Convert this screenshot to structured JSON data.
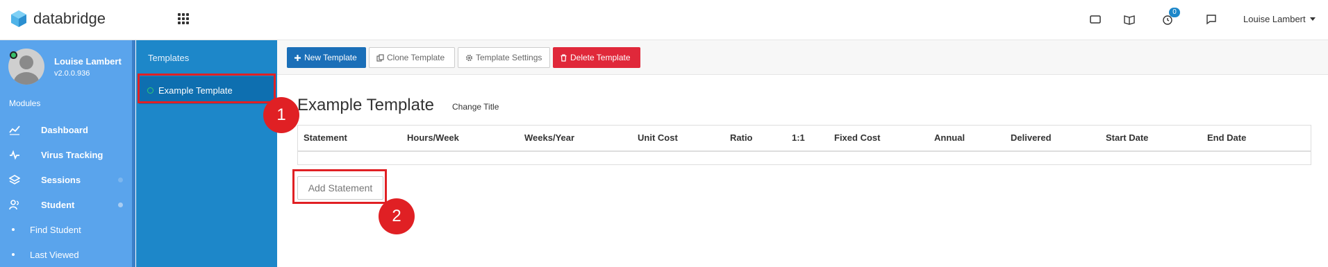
{
  "app": {
    "brand": "databridge",
    "brand_color": "#4fb3e8"
  },
  "topbar": {
    "icons": [
      "tablet-icon",
      "book-icon",
      "clock-icon",
      "chat-icon"
    ],
    "notification_count": "0",
    "user_name": "Louise Lambert"
  },
  "sidebar": {
    "profile_name": "Louise Lambert",
    "version": "v2.0.0.936",
    "modules_label": "Modules",
    "items": [
      {
        "label": "Dashboard",
        "icon": "chart-line-icon"
      },
      {
        "label": "Virus Tracking",
        "icon": "pulse-icon"
      },
      {
        "label": "Sessions",
        "icon": "layers-icon"
      },
      {
        "label": "Student",
        "icon": "students-icon"
      }
    ],
    "sub_items": [
      {
        "label": "Find Student"
      },
      {
        "label": "Last Viewed"
      }
    ]
  },
  "templates_panel": {
    "heading": "Templates",
    "items": [
      {
        "label": "Example Template"
      }
    ]
  },
  "toolbar": {
    "new_label": "New Template",
    "clone_label": "Clone Template",
    "settings_label": "Template Settings",
    "delete_label": "Delete Template"
  },
  "main": {
    "title": "Example Template",
    "change_title_label": "Change Title",
    "columns": [
      "Statement",
      "Hours/Week",
      "Weeks/Year",
      "Unit Cost",
      "Ratio",
      "1:1",
      "Fixed Cost",
      "Annual",
      "Delivered",
      "Start Date",
      "End Date"
    ],
    "add_statement_label": "Add Statement"
  },
  "annotations": {
    "labels": [
      "1",
      "2"
    ],
    "color": "#e02024"
  }
}
